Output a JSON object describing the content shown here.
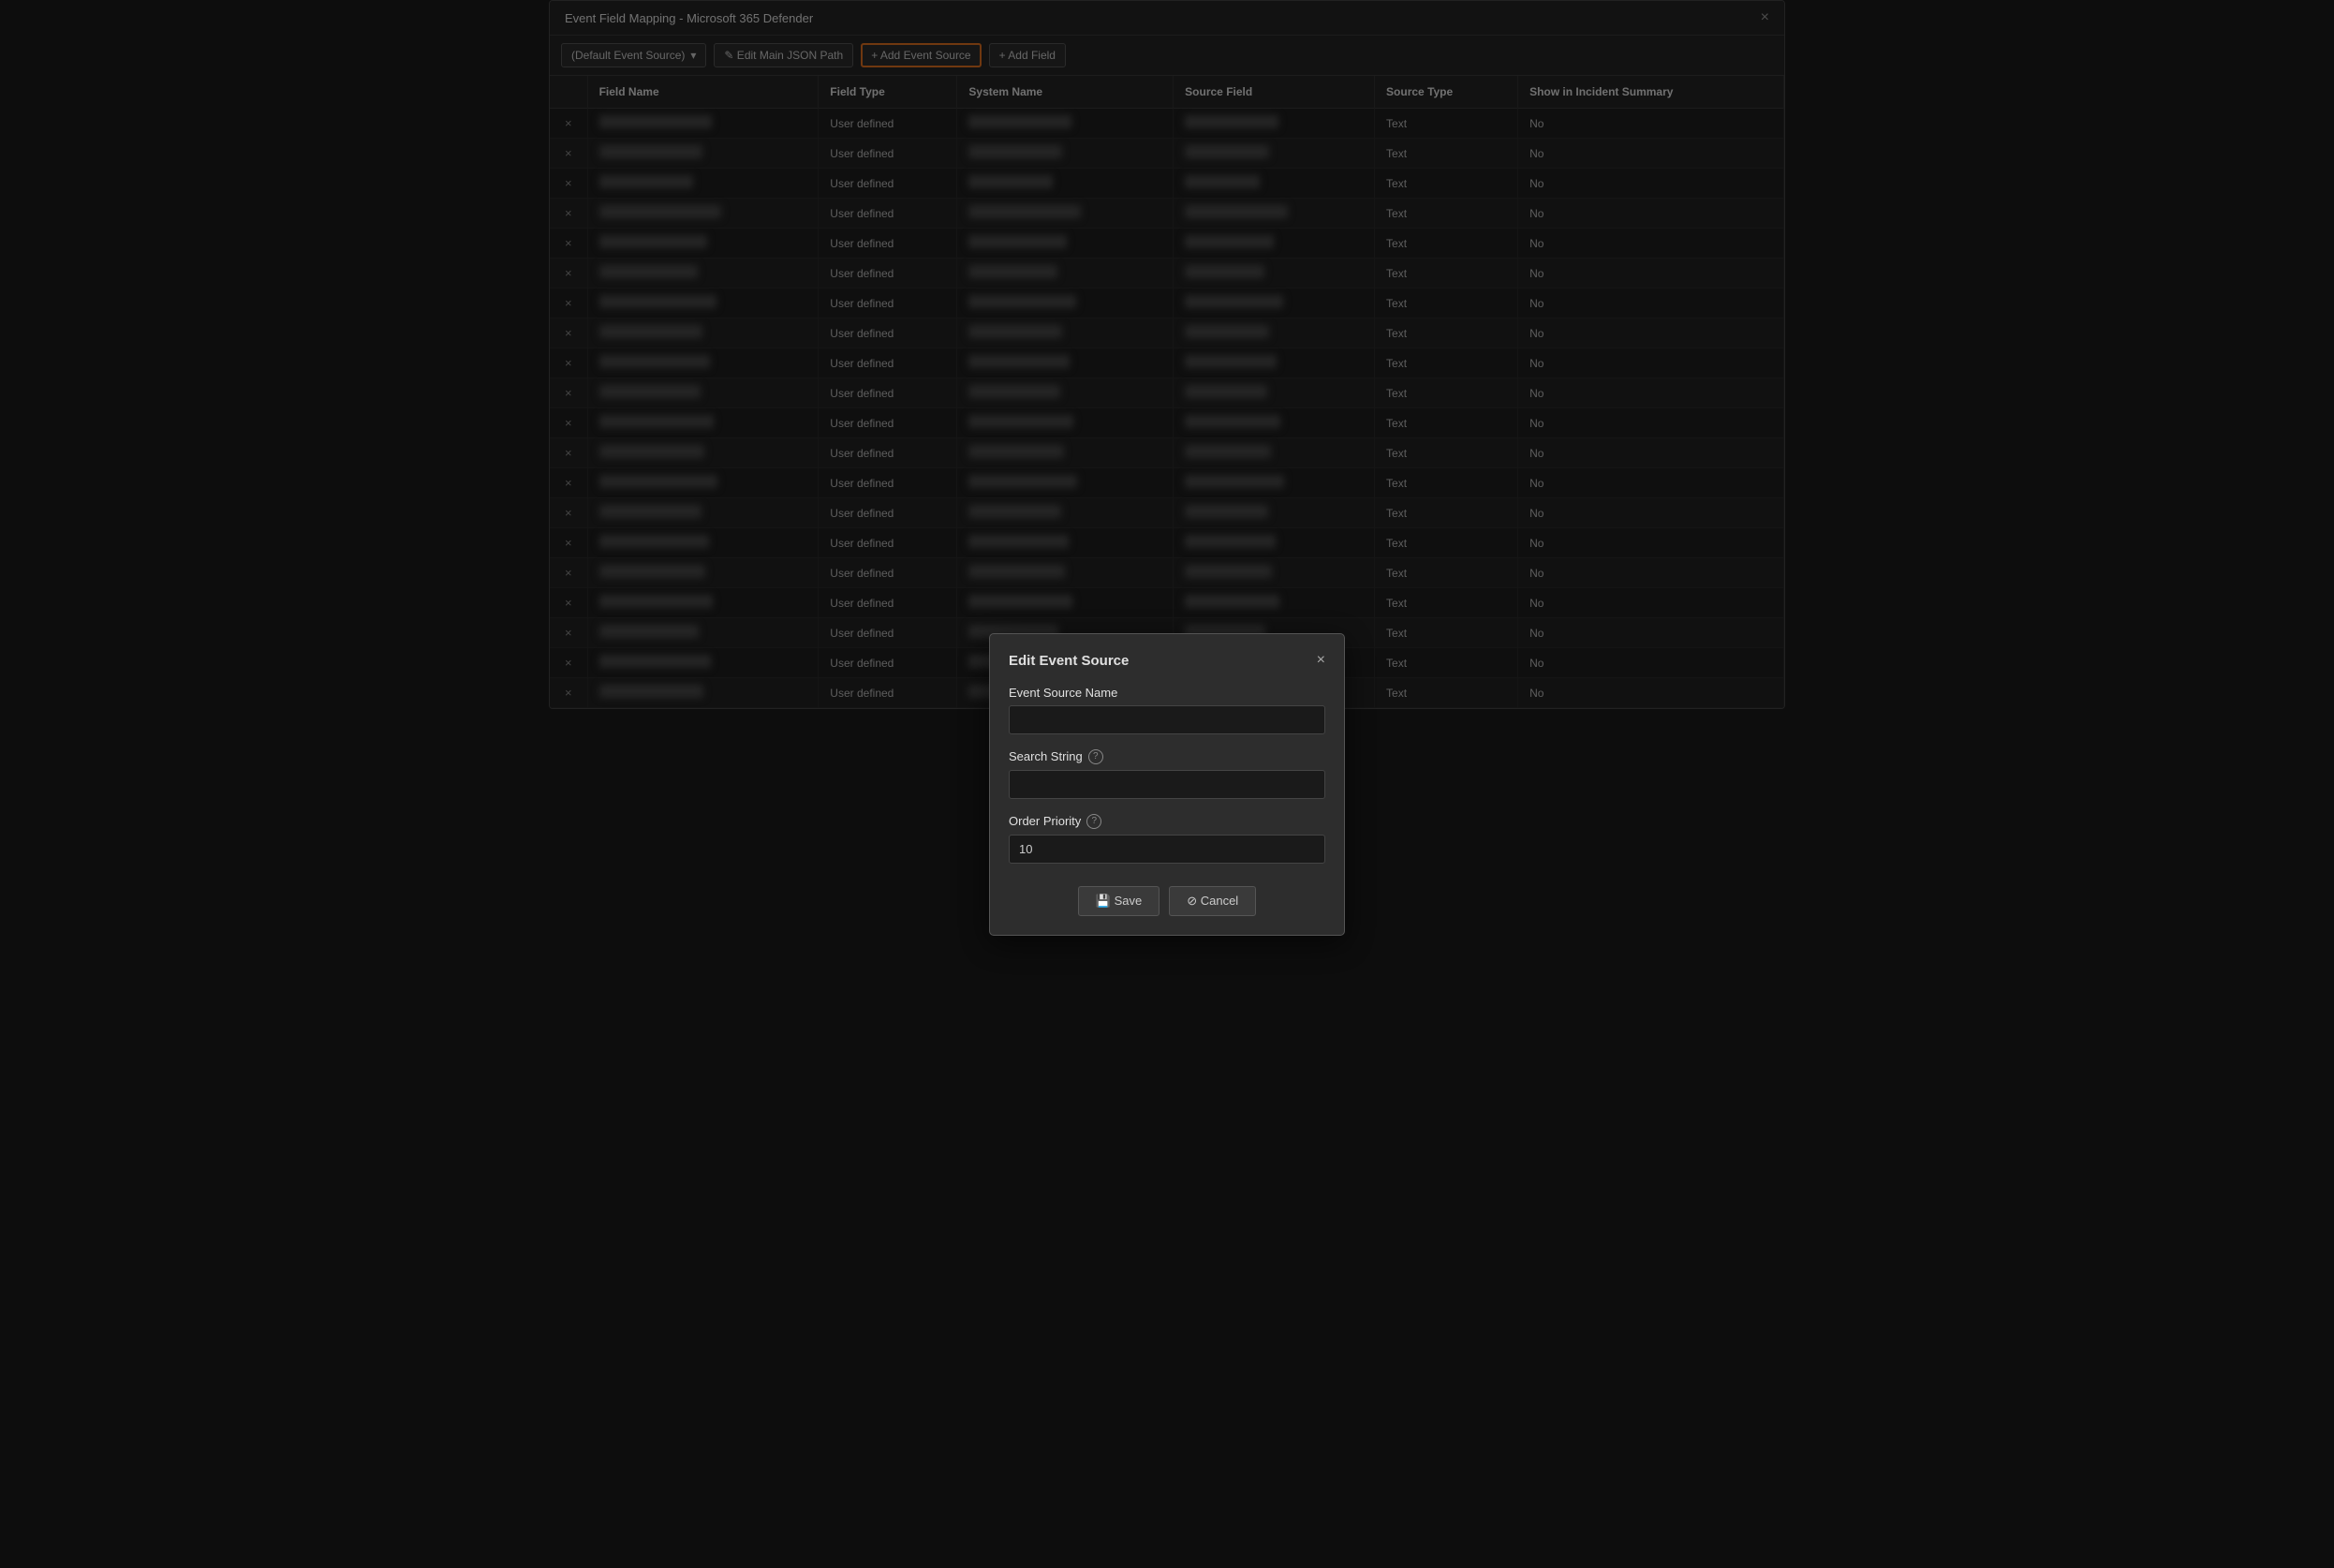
{
  "window": {
    "title": "Event Field Mapping - Microsoft 365 Defender",
    "close_label": "×"
  },
  "toolbar": {
    "dropdown_label": "(Default Event Source)",
    "dropdown_icon": "▾",
    "edit_main_json_path_label": "✎ Edit Main JSON Path",
    "add_event_source_label": "+ Add Event Source",
    "add_field_label": "+ Add Field"
  },
  "table": {
    "columns": [
      "",
      "Field Name",
      "Field Type",
      "System Name",
      "Source Field",
      "Source Type",
      "Show in Incident Summary"
    ],
    "rows": [
      {
        "field_type": "User defined",
        "source_type": "Text",
        "show_in_summary": "No"
      },
      {
        "field_type": "User defined",
        "source_type": "Text",
        "show_in_summary": "No"
      },
      {
        "field_type": "User defined",
        "source_type": "Text",
        "show_in_summary": "No"
      },
      {
        "field_type": "User defined",
        "source_type": "Text",
        "show_in_summary": "No"
      },
      {
        "field_type": "User defined",
        "source_type": "Text",
        "show_in_summary": "No"
      },
      {
        "field_type": "User defined",
        "source_type": "Text",
        "show_in_summary": "No"
      },
      {
        "field_type": "User defined",
        "source_type": "Text",
        "show_in_summary": "No"
      },
      {
        "field_type": "User defined",
        "source_type": "Text",
        "show_in_summary": "No"
      },
      {
        "field_type": "User defined",
        "source_type": "Text",
        "show_in_summary": "No"
      },
      {
        "field_type": "User defined",
        "source_type": "Text",
        "show_in_summary": "No"
      },
      {
        "field_type": "User defined",
        "source_type": "Text",
        "show_in_summary": "No"
      },
      {
        "field_type": "User defined",
        "source_type": "Text",
        "show_in_summary": "No"
      },
      {
        "field_type": "User defined",
        "source_type": "Text",
        "show_in_summary": "No"
      },
      {
        "field_type": "User defined",
        "source_type": "Text",
        "show_in_summary": "No"
      },
      {
        "field_type": "User defined",
        "source_type": "Text",
        "show_in_summary": "No"
      },
      {
        "field_type": "User defined",
        "source_type": "Text",
        "show_in_summary": "No"
      },
      {
        "field_type": "User defined",
        "source_type": "Text",
        "show_in_summary": "No"
      },
      {
        "field_type": "User defined",
        "source_type": "Text",
        "show_in_summary": "No"
      },
      {
        "field_type": "User defined",
        "source_type": "Text",
        "show_in_summary": "No"
      },
      {
        "field_type": "User defined",
        "source_type": "Text",
        "show_in_summary": "No"
      }
    ]
  },
  "modal": {
    "title": "Edit Event Source",
    "close_label": "×",
    "event_source_name_label": "Event Source Name",
    "event_source_name_placeholder": "",
    "search_string_label": "Search String",
    "search_string_help": "?",
    "search_string_placeholder": "",
    "order_priority_label": "Order Priority",
    "order_priority_help": "?",
    "order_priority_value": "10",
    "save_label": "💾 Save",
    "cancel_label": "⊘ Cancel"
  },
  "blur_widths": {
    "field_name": [
      120,
      110,
      100,
      130,
      115,
      105,
      125,
      110,
      118,
      108,
      122,
      112,
      126,
      109,
      117,
      113,
      121,
      106,
      119,
      111
    ],
    "system_name": [
      110,
      100,
      90,
      120,
      105,
      95,
      115,
      100,
      108,
      98,
      112,
      102,
      116,
      99,
      107,
      103,
      111,
      96,
      109,
      101
    ],
    "source_field": [
      100,
      90,
      80,
      110,
      95,
      85,
      105,
      90,
      98,
      88,
      102,
      92,
      106,
      89,
      97,
      93,
      101,
      86,
      99,
      91
    ]
  }
}
